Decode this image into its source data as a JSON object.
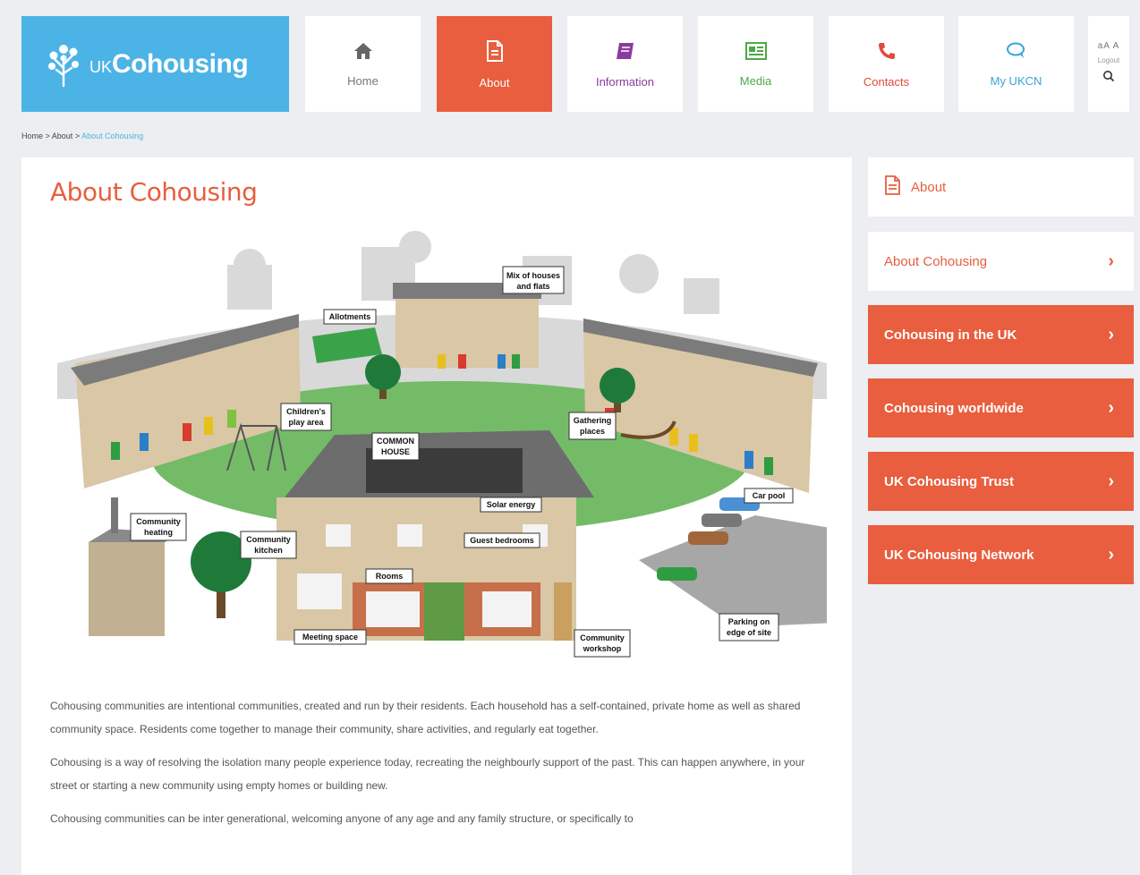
{
  "brand": {
    "logo_prefix": "UK",
    "logo_name": "Cohousing"
  },
  "nav": {
    "home": "Home",
    "about": "About",
    "information": "Information",
    "media": "Media",
    "contacts": "Contacts",
    "myuken": "My UKCN"
  },
  "utility": {
    "text_size": "aA A",
    "logout": "Logout"
  },
  "breadcrumb": {
    "home": "Home",
    "sep1": " > ",
    "about": "About",
    "sep2": " > ",
    "current": "About Cohousing"
  },
  "page": {
    "title": "About Cohousing"
  },
  "illustration": {
    "labels": {
      "mix_houses_1": "Mix of houses",
      "mix_houses_2": "and flats",
      "allotments": "Allotments",
      "childrens_play_1": "Children's",
      "childrens_play_2": "play area",
      "common_house_1": "COMMON",
      "common_house_2": "HOUSE",
      "gathering_1": "Gathering",
      "gathering_2": "places",
      "solar": "Solar energy",
      "car_pool": "Car pool",
      "community_heating_1": "Community",
      "community_heating_2": "heating",
      "community_kitchen_1": "Community",
      "community_kitchen_2": "kitchen",
      "guest_bedrooms": "Guest bedrooms",
      "rooms": "Rooms",
      "parking_1": "Parking on",
      "parking_2": "edge of site",
      "meeting_space": "Meeting space",
      "workshop_1": "Community",
      "workshop_2": "workshop"
    }
  },
  "body": {
    "p1": "Cohousing communities are intentional communities, created and run by their residents. Each household has a self-contained, private home as well as shared community space. Residents come together to manage their community, share activities, and regularly eat together.",
    "p2": "Cohousing is a way of resolving the isolation many people experience today, recreating the neighbourly support of the past. This can happen anywhere, in your street or starting a new community using empty homes or building new.",
    "p3": "Cohousing communities can be inter generational, welcoming anyone of any age and any family structure, or specifically to"
  },
  "sidebar": {
    "heading": "About",
    "items": [
      {
        "label": "About Cohousing"
      },
      {
        "label": "Cohousing in the UK"
      },
      {
        "label": "Cohousing worldwide"
      },
      {
        "label": "UK Cohousing Trust"
      },
      {
        "label": "UK Cohousing Network"
      }
    ]
  },
  "colors": {
    "brand_blue": "#4cb3e6",
    "accent_orange": "#e85e3e",
    "page_bg": "#eceef1"
  }
}
